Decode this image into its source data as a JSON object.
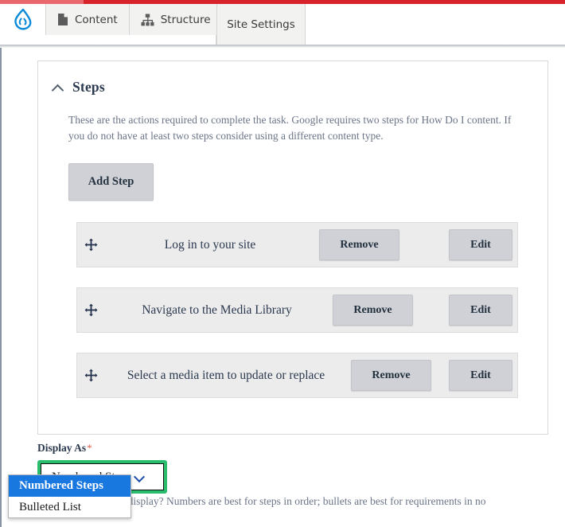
{
  "toolbar": {
    "logo_icon": "drupal-droplet-icon",
    "items": [
      {
        "label": "Content",
        "icon": "document-icon"
      },
      {
        "label": "Structure",
        "icon": "sitemap-icon"
      }
    ],
    "active_tab": "Site Settings"
  },
  "panel": {
    "title": "Steps",
    "collapse_icon": "chevron-up-icon",
    "description": "These are the actions required to complete the task. Google requires two steps for How Do I content. If you do not have at least two steps consider using a different content type.",
    "add_button": "Add Step",
    "remove_button": "Remove",
    "edit_button": "Edit",
    "drag_icon": "move-handle-icon",
    "steps": [
      {
        "label": "Log in to your site"
      },
      {
        "label": "Navigate to the Media Library"
      },
      {
        "label": "Select a media item to update or replace"
      }
    ]
  },
  "display_as": {
    "label": "Display As",
    "required_marker": "*",
    "selected": "Numbered Steps",
    "caret_icon": "chevron-down-icon",
    "options": [
      {
        "label": "Numbered Steps",
        "selected": true
      },
      {
        "label": "Bulleted List",
        "selected": false
      }
    ],
    "description": "How do you want to display? Numbers are best for steps in order; bullets are best for requirements in no"
  },
  "colors": {
    "brand_red": "#d8232a",
    "focus_green": "#2bbd6e",
    "option_blue": "#1878e0",
    "drupal_blue": "#0c8bd9",
    "required_red": "#e05b4b"
  }
}
